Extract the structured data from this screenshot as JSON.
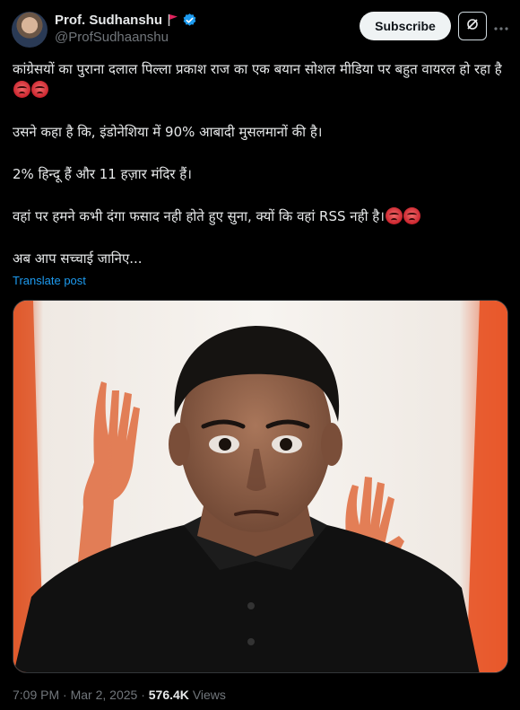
{
  "author": {
    "name": "Prof. Sudhanshu",
    "handle": "@ProfSudhaanshu",
    "verified": true,
    "flag_color": "#e0245e",
    "verified_color": "#1d9bf0"
  },
  "actions": {
    "subscribe_label": "Subscribe",
    "grok_icon": "grok-icon",
    "more_icon": "more-icon"
  },
  "post": {
    "line1": "कांग्रेसयों का पुराना दलाल पिल्ला प्रकाश राज का एक बयान सोशल मीडिया पर बहुत वायरल हो रहा है",
    "line2": "उसने कहा है कि, इंडोनेशिया में 90% आबादी मुसलमानों की है।",
    "line3": "2% हिन्दू हैं और 11 हज़ार मंदिर हैं।",
    "line4": "वहां पर हमने कभी दंगा फसाद नही होते हुए सुना, क्यों कि वहां RSS नही है।",
    "line5": "अब आप सच्चाई जानिए...",
    "emoji": "angry-face-icon",
    "translate_label": "Translate post"
  },
  "media": {
    "description_icon": "photo-man-black-shirt",
    "accent_color": "#e8572a"
  },
  "meta": {
    "time": "7:09 PM",
    "separator": "·",
    "date": "Mar 2, 2025",
    "views_count": "576.4K",
    "views_label": "Views"
  }
}
